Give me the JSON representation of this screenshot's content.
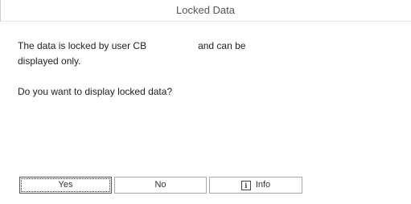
{
  "dialog": {
    "title": "Locked Data",
    "message": {
      "line1_prefix": "The data is locked by user CB",
      "line1_suffix": "and can be",
      "line2": "displayed only.",
      "question": "Do you want to display locked data?"
    },
    "buttons": {
      "yes": "Yes",
      "no": "No",
      "info": "Info"
    },
    "icons": {
      "info": "info-icon"
    }
  }
}
